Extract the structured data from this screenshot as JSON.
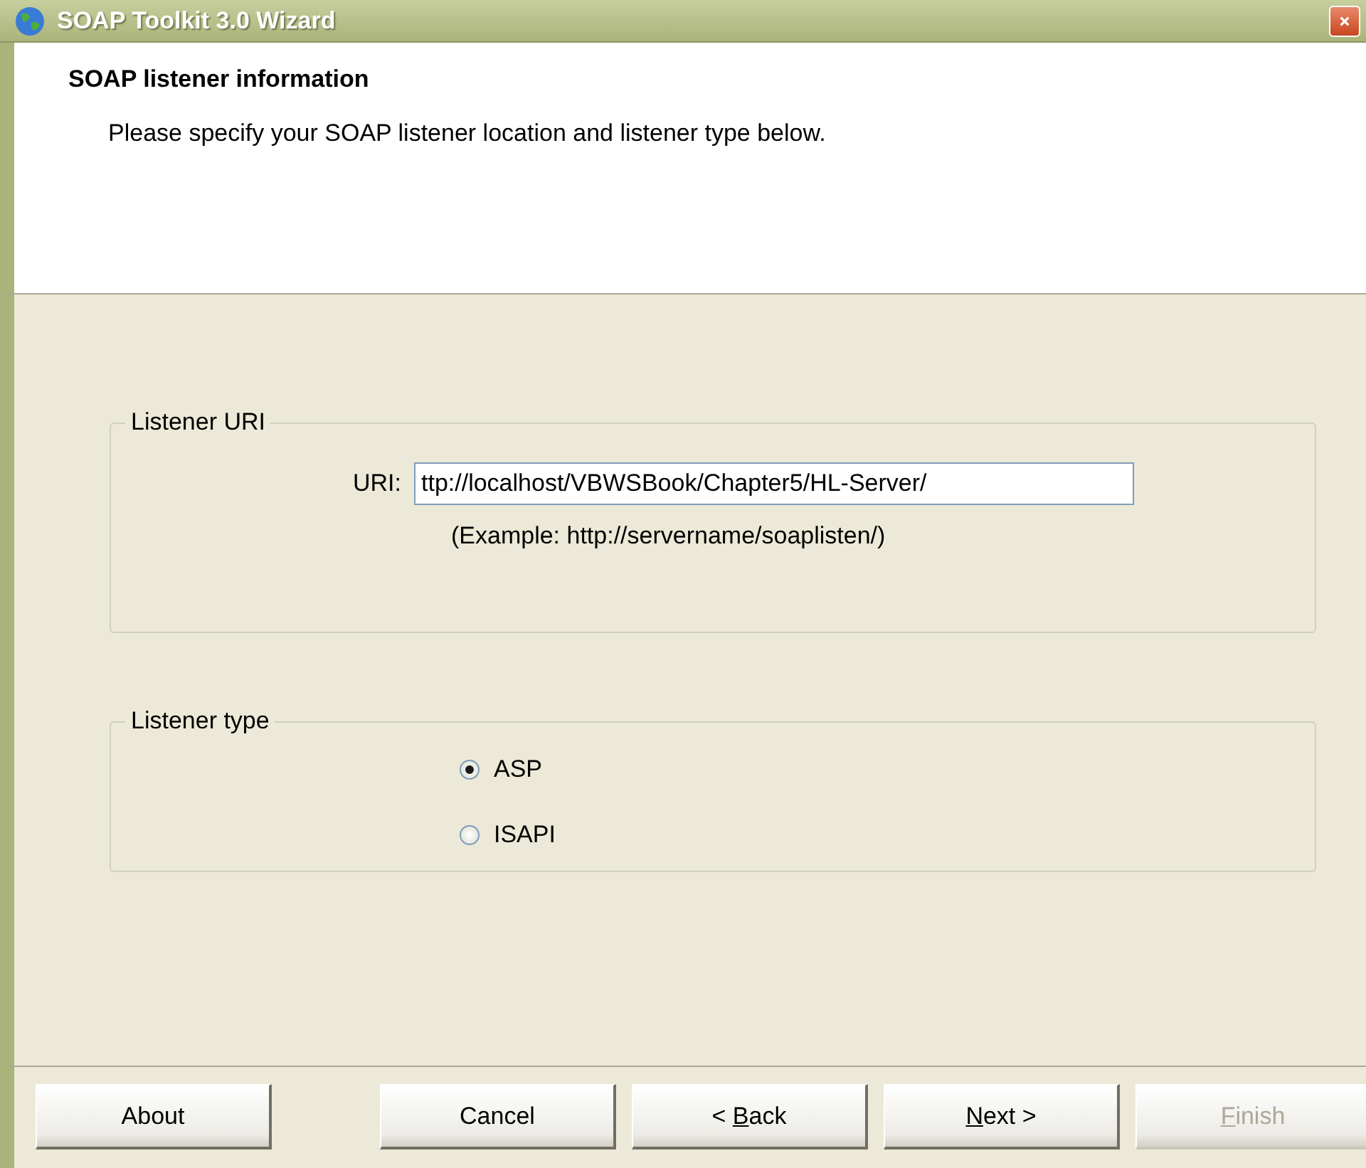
{
  "window": {
    "title": "SOAP Toolkit 3.0 Wizard"
  },
  "header": {
    "title": "SOAP listener information",
    "subtitle": "Please specify your SOAP listener location and listener type below."
  },
  "listener_uri": {
    "legend": "Listener URI",
    "label": "URI:",
    "value": "ttp://localhost/VBWSBook/Chapter5/HL-Server/",
    "example": "(Example: http://servername/soaplisten/)"
  },
  "listener_type": {
    "legend": "Listener type",
    "options": [
      {
        "label": "ASP",
        "selected": true
      },
      {
        "label": "ISAPI",
        "selected": false
      }
    ]
  },
  "buttons": [
    {
      "label": [
        {
          "text": "About",
          "underlined": false
        }
      ],
      "disabled": false
    },
    {
      "label": [
        {
          "text": "Cancel",
          "underlined": false
        }
      ],
      "disabled": false
    },
    {
      "label": [
        {
          "text": "< ",
          "underlined": false
        },
        {
          "text": "B",
          "underlined": true
        },
        {
          "text": "ack",
          "underlined": false
        }
      ],
      "disabled": false
    },
    {
      "label": [
        {
          "text": "N",
          "underlined": true
        },
        {
          "text": "ext >",
          "underlined": false
        }
      ],
      "disabled": false
    },
    {
      "label": [
        {
          "text": "F",
          "underlined": true
        },
        {
          "text": "inish",
          "underlined": false
        }
      ],
      "disabled": true
    }
  ]
}
